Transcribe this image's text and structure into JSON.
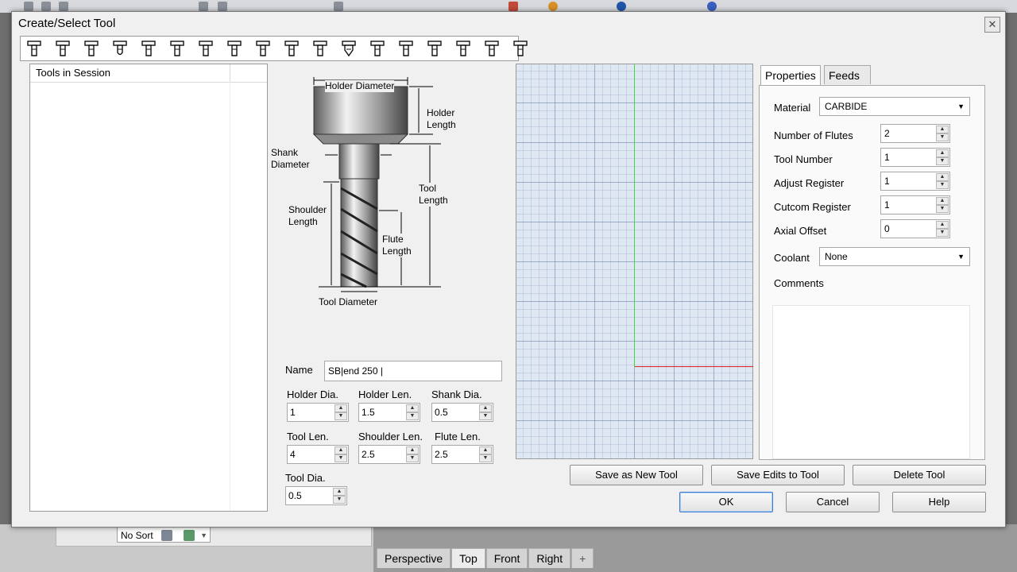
{
  "background": {
    "sort_select": "No Sort",
    "view_tabs": [
      "Perspective",
      "Top",
      "Front",
      "Right",
      "+"
    ],
    "active_view": "Top"
  },
  "dialog": {
    "title": "Create/Select Tool",
    "close_glyph": "✕",
    "tool_strip_icons": [
      "end-mill-icon",
      "end-mill-icon",
      "end-mill-icon",
      "ball-mill-icon",
      "end-mill-icon",
      "end-mill-icon",
      "end-mill-icon",
      "end-mill-icon",
      "end-mill-icon",
      "end-mill-icon",
      "end-mill-icon",
      "custom-tool-icon",
      "end-mill-icon",
      "end-mill-icon",
      "end-mill-icon",
      "end-mill-icon",
      "end-mill-icon",
      "end-mill-icon"
    ]
  },
  "session": {
    "header": "Tools in Session"
  },
  "diagram": {
    "holder_diameter": "Holder Diameter",
    "holder_length": "Holder\nLength",
    "shank_diameter": "Shank\nDiameter",
    "tool_length": "Tool\nLength",
    "shoulder_length": "Shoulder\nLength",
    "flute_length": "Flute\nLength",
    "tool_diameter": "Tool Diameter"
  },
  "name": {
    "label": "Name",
    "value": "SB|end 250 |"
  },
  "params": {
    "holder_dia": {
      "label": "Holder Dia.",
      "value": "1"
    },
    "holder_len": {
      "label": "Holder Len.",
      "value": "1.5"
    },
    "shank_dia": {
      "label": "Shank Dia.",
      "value": "0.5"
    },
    "tool_len": {
      "label": "Tool Len.",
      "value": "4"
    },
    "shoulder_len": {
      "label": "Shoulder Len.",
      "value": "2.5"
    },
    "flute_len": {
      "label": "Flute Len.",
      "value": "2.5"
    },
    "tool_dia": {
      "label": "Tool Dia.",
      "value": "0.5"
    }
  },
  "tabs": {
    "properties": "Properties",
    "feeds": "Feeds & Speeds",
    "active": "Properties"
  },
  "properties": {
    "material_label": "Material",
    "material_value": "CARBIDE",
    "flutes_label": "Number of Flutes",
    "flutes_value": "2",
    "tool_number_label": "Tool Number",
    "tool_number_value": "1",
    "adjust_label": "Adjust Register",
    "adjust_value": "1",
    "cutcom_label": "Cutcom Register",
    "cutcom_value": "1",
    "axial_label": "Axial Offset",
    "axial_value": "0",
    "coolant_label": "Coolant",
    "coolant_value": "None",
    "comments_label": "Comments"
  },
  "buttons": {
    "save_new": "Save as New Tool",
    "save_edits": "Save Edits to Tool",
    "delete": "Delete Tool",
    "ok": "OK",
    "cancel": "Cancel",
    "help": "Help"
  },
  "colors": {
    "preview_grid_bg": "#dfe8f2",
    "y_axis": "#3ddc3d",
    "x_axis": "#e02020",
    "ok_border": "#3d7bd6"
  }
}
